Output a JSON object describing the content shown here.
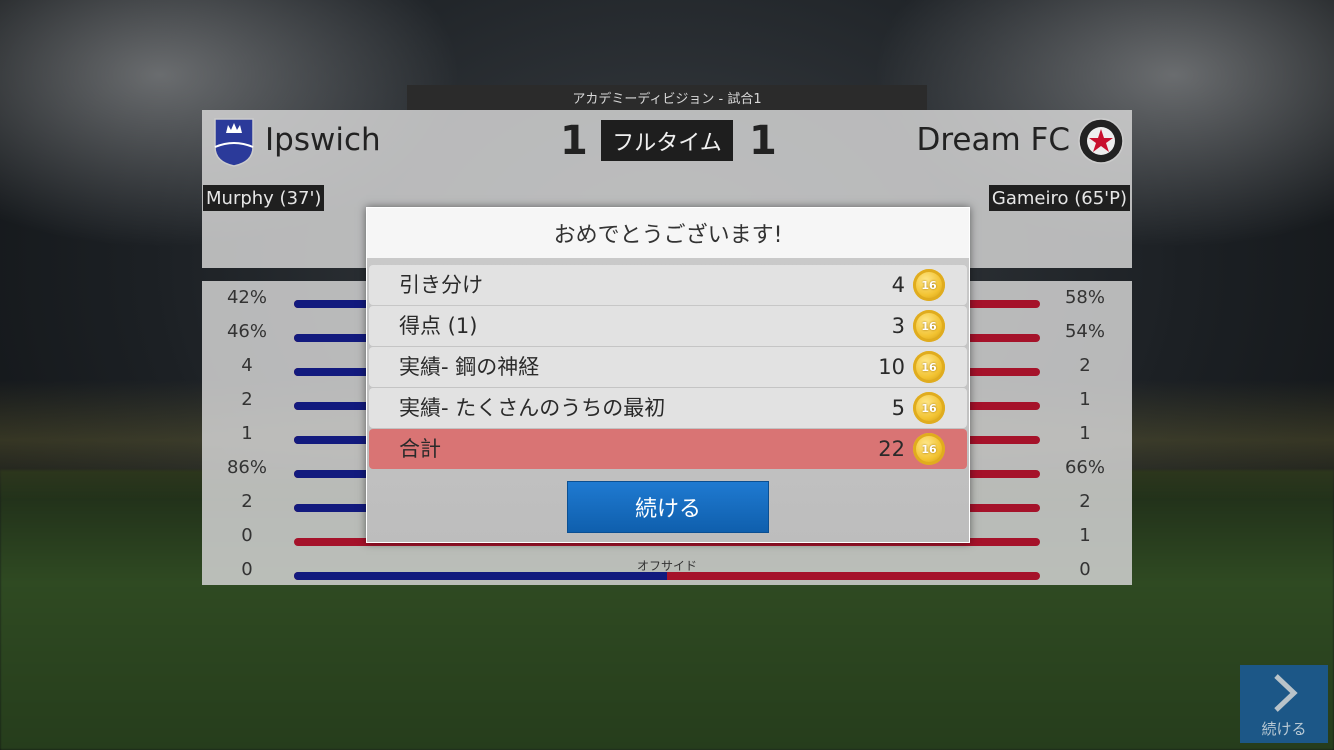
{
  "division": "アカデミーディビジョン - 試合1",
  "match": {
    "home_team": "Ipswich",
    "away_team": "Dream FC",
    "home_score": "1",
    "away_score": "1",
    "status": "フルタイム",
    "home_scorer": "Murphy (37')",
    "away_scorer": "Gameiro (65'P)",
    "home_color": "#121a7e",
    "away_color": "#a5122a"
  },
  "stats": [
    {
      "home": "42%",
      "away": "58%",
      "home_share": 0.42,
      "label": ""
    },
    {
      "home": "46%",
      "away": "54%",
      "home_share": 0.46,
      "label": ""
    },
    {
      "home": "4",
      "away": "2",
      "home_share": 0.67,
      "label": ""
    },
    {
      "home": "2",
      "away": "1",
      "home_share": 0.67,
      "label": ""
    },
    {
      "home": "1",
      "away": "1",
      "home_share": 0.5,
      "label": ""
    },
    {
      "home": "86%",
      "away": "66%",
      "home_share": 0.57,
      "label": ""
    },
    {
      "home": "2",
      "away": "2",
      "home_share": 0.5,
      "label": ""
    },
    {
      "home": "0",
      "away": "1",
      "home_share": 0.0,
      "label": ""
    },
    {
      "home": "0",
      "away": "0",
      "home_share": 0.5,
      "label": "オフサイド"
    }
  ],
  "modal": {
    "title": "おめでとうございます!",
    "rewards": [
      {
        "label": "引き分け",
        "value": "4"
      },
      {
        "label": "得点 (1)",
        "value": "3"
      },
      {
        "label": "実績- 鋼の神経",
        "value": "10"
      },
      {
        "label": "実績- たくさんのうちの最初",
        "value": "5"
      }
    ],
    "total": {
      "label": "合計",
      "value": "22"
    },
    "coin_text": "16",
    "continue_label": "続ける"
  },
  "corner": {
    "continue_label": "続ける",
    "icon": "chevron-right-icon"
  }
}
